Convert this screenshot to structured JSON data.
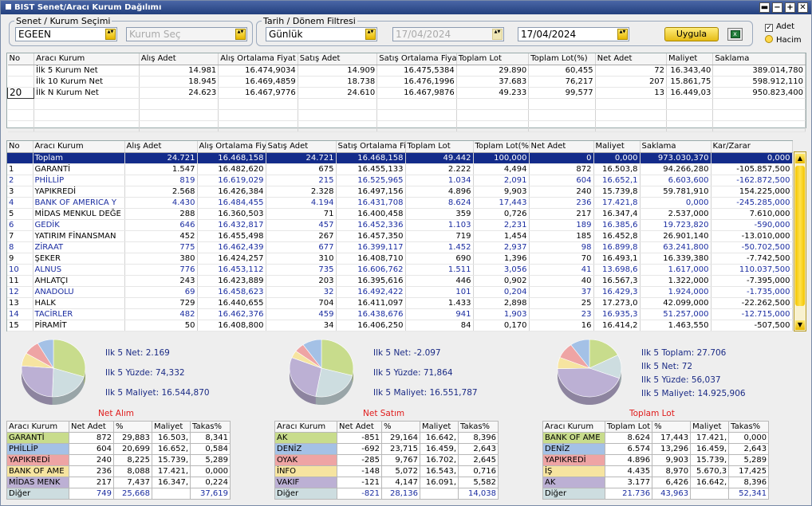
{
  "title": "BIST Senet/Aracı Kurum Dağılımı",
  "wbtns": [
    "▬",
    "−",
    "+",
    "✕"
  ],
  "senet": {
    "legend": "Senet / Kurum Seçimi",
    "symbol": "EGEEN",
    "kurum_placeholder": "Kurum Seç"
  },
  "tarih": {
    "legend": "Tarih / Dönem Filtresi",
    "period": "Günlük",
    "date1": "17/04/2024",
    "date2": "17/04/2024"
  },
  "uygula": "Uygula",
  "excel_icon": "excel-icon",
  "options": {
    "adet": "Adet",
    "hacim": "Hacim"
  },
  "summary": {
    "columns": [
      "No",
      "Aracı Kurum",
      "Alış Adet",
      "Alış Ortalama Fiyat",
      "Satış Adet",
      "Satış Ortalama Fiyat",
      "Toplam Lot",
      "Toplam Lot(%)",
      "Net Adet",
      "Maliyet",
      "Saklama"
    ],
    "rows": [
      [
        "",
        "İlk 5 Kurum Net",
        "14.981",
        "16.474,9034",
        "14.909",
        "16.475,5384",
        "29.890",
        "60,455",
        "72",
        "16.343,40",
        "389.014,780"
      ],
      [
        "",
        "İlk 10 Kurum Net",
        "18.945",
        "16.469,4859",
        "18.738",
        "16.476,1996",
        "37.683",
        "76,217",
        "207",
        "15.861,75",
        "598.912,110"
      ],
      [
        "20",
        "İlk N Kurum Net",
        "24.623",
        "16.467,9776",
        "24.610",
        "16.467,9876",
        "49.233",
        "99,577",
        "13",
        "16.449,03",
        "950.823,400"
      ]
    ]
  },
  "main": {
    "columns": [
      "No",
      "Aracı Kurum",
      "Alış Adet",
      "Alış Ortalama Fiy",
      "Satış Adet",
      "Satış Ortalama Fi",
      "Toplam Lot",
      "Toplam Lot(%",
      "Net Adet",
      "Maliyet",
      "Saklama",
      "Kar/Zarar"
    ],
    "rows": [
      [
        "",
        "Toplam",
        "24.721",
        "16.468,158",
        "24.721",
        "16.468,158",
        "49.442",
        "100,000",
        "0",
        "0,000",
        "973.030,370",
        "0,000"
      ],
      [
        "1",
        "GARANTİ",
        "1.547",
        "16.482,620",
        "675",
        "16.455,133",
        "2.222",
        "4,494",
        "872",
        "16.503,8",
        "94.266,280",
        "-105.857,500"
      ],
      [
        "2",
        "PHİLLİP",
        "819",
        "16.619,029",
        "215",
        "16.525,965",
        "1.034",
        "2,091",
        "604",
        "16.652,1",
        "6.603,600",
        "-162.872,500"
      ],
      [
        "3",
        "YAPIKREDİ",
        "2.568",
        "16.426,384",
        "2.328",
        "16.497,156",
        "4.896",
        "9,903",
        "240",
        "15.739,8",
        "59.781,910",
        "154.225,000"
      ],
      [
        "4",
        "BANK OF AMERICA Y",
        "4.430",
        "16.484,455",
        "4.194",
        "16.431,708",
        "8.624",
        "17,443",
        "236",
        "17.421,8",
        "0,000",
        "-245.285,000"
      ],
      [
        "5",
        "MİDAS MENKUL DEĞE",
        "288",
        "16.360,503",
        "71",
        "16.400,458",
        "359",
        "0,726",
        "217",
        "16.347,4",
        "2.537,000",
        "7.610,000"
      ],
      [
        "6",
        "GEDİK",
        "646",
        "16.432,817",
        "457",
        "16.452,336",
        "1.103",
        "2,231",
        "189",
        "16.385,6",
        "19.723,820",
        "-590,000"
      ],
      [
        "7",
        "YATIRIM FİNANSMAN",
        "452",
        "16.455,498",
        "267",
        "16.457,350",
        "719",
        "1,454",
        "185",
        "16.452,8",
        "26.901,140",
        "-13.010,000"
      ],
      [
        "8",
        "ZİRAAT",
        "775",
        "16.462,439",
        "677",
        "16.399,117",
        "1.452",
        "2,937",
        "98",
        "16.899,8",
        "63.241,800",
        "-50.702,500"
      ],
      [
        "9",
        "ŞEKER",
        "380",
        "16.424,257",
        "310",
        "16.408,710",
        "690",
        "1,396",
        "70",
        "16.493,1",
        "16.339,380",
        "-7.742,500"
      ],
      [
        "10",
        "ALNUS",
        "776",
        "16.453,112",
        "735",
        "16.606,762",
        "1.511",
        "3,056",
        "41",
        "13.698,6",
        "1.617,000",
        "110.037,500"
      ],
      [
        "11",
        "AHLATÇI",
        "243",
        "16.423,889",
        "203",
        "16.395,616",
        "446",
        "0,902",
        "40",
        "16.567,3",
        "1.322,000",
        "-7.395,000"
      ],
      [
        "12",
        "ANADOLU",
        "69",
        "16.458,623",
        "32",
        "16.492,422",
        "101",
        "0,204",
        "37",
        "16.429,3",
        "1.924,000",
        "-1.735,000"
      ],
      [
        "13",
        "HALK",
        "729",
        "16.440,655",
        "704",
        "16.411,097",
        "1.433",
        "2,898",
        "25",
        "17.273,0",
        "42.099,000",
        "-22.262,500"
      ],
      [
        "14",
        "TACİRLER",
        "482",
        "16.462,376",
        "459",
        "16.438,676",
        "941",
        "1,903",
        "23",
        "16.935,3",
        "51.257,000",
        "-12.715,000"
      ],
      [
        "15",
        "PİRAMİT",
        "50",
        "16.408,800",
        "34",
        "16.406,250",
        "84",
        "0,170",
        "16",
        "16.414,2",
        "1.463,550",
        "-507,500"
      ]
    ]
  },
  "scroll": {
    "up": "▲",
    "down": "▼"
  },
  "net_alim": {
    "title": "Net Alım",
    "info": [
      "Ilk 5 Net: 2.169",
      "Ilk 5 Yüzde: 74,332",
      "Ilk 5 Maliyet: 16.544,870"
    ],
    "pie": [
      29.883,
      8.225,
      8.088,
      7.437,
      25.668,
      20.699
    ],
    "columns": [
      "Aracı Kurum",
      "Net Adet",
      "%",
      "Maliyet",
      "Takas%"
    ],
    "rows": [
      [
        "GARANTİ",
        "872",
        "29,883",
        "16.503,",
        "8,341"
      ],
      [
        "PHİLLİP",
        "604",
        "20,699",
        "16.652,",
        "0,584"
      ],
      [
        "YAPIKREDİ",
        "240",
        "8,225",
        "15.739,",
        "5,289"
      ],
      [
        "BANK OF AME",
        "236",
        "8,088",
        "17.421,",
        "0,000"
      ],
      [
        "MİDAS MENK",
        "217",
        "7,437",
        "16.347,",
        "0,224"
      ],
      [
        "Diğer",
        "749",
        "25,668",
        "",
        "37,619"
      ]
    ]
  },
  "net_satim": {
    "title": "Net Satım",
    "info": [
      "Ilk 5 Net: -2.097",
      "Ilk 5 Yüzde: 71,864",
      "Ilk 5 Maliyet: 16.551,787"
    ],
    "pie": [
      29.164,
      9.767,
      5.072,
      4.147,
      28.136,
      23.715
    ],
    "columns": [
      "Aracı Kurum",
      "Net Adet",
      "%",
      "Maliyet",
      "Takas%"
    ],
    "rows": [
      [
        "AK",
        "-851",
        "29,164",
        "16.642,",
        "8,396"
      ],
      [
        "DENİZ",
        "-692",
        "23,715",
        "16.459,",
        "2,643"
      ],
      [
        "OYAK",
        "-285",
        "9,767",
        "16.702,",
        "2,645"
      ],
      [
        "İNFO",
        "-148",
        "5,072",
        "16.543,",
        "0,716"
      ],
      [
        "VAKIF",
        "-121",
        "4,147",
        "16.091,",
        "5,582"
      ],
      [
        "Diğer",
        "-821",
        "28,136",
        "",
        "14,038"
      ]
    ]
  },
  "toplam_lot": {
    "title": "Toplam Lot",
    "info": [
      "Ilk 5 Toplam: 27.706",
      "Ilk 5 Net: 72",
      "Ilk 5 Yüzde: 56,037",
      "Ilk 5 Maliyet: 14.925,906"
    ],
    "pie": [
      17.443,
      9.903,
      8.97,
      6.426,
      43.963,
      13.296
    ],
    "columns": [
      "Aracı Kurum",
      "Toplam Lot",
      "%",
      "Maliyet",
      "Takas%"
    ],
    "rows": [
      [
        "BANK OF AME",
        "8.624",
        "17,443",
        "17.421,",
        "0,000"
      ],
      [
        "DENİZ",
        "6.574",
        "13,296",
        "16.459,",
        "2,643"
      ],
      [
        "YAPIKREDİ",
        "4.896",
        "9,903",
        "15.739,",
        "5,289"
      ],
      [
        "İŞ",
        "4.435",
        "8,970",
        "5.670,3",
        "17,425"
      ],
      [
        "AK",
        "3.177",
        "6,426",
        "16.642,",
        "8,396"
      ],
      [
        "Diğer",
        "21.736",
        "43,963",
        "",
        "52,341"
      ]
    ]
  },
  "colors": {
    "c1": "#c8dc8c",
    "c2": "#a4c1e6",
    "c3": "#eea4a4",
    "c4": "#f6e4a0",
    "c5": "#bcb0d4",
    "c6": "#cddde0"
  }
}
